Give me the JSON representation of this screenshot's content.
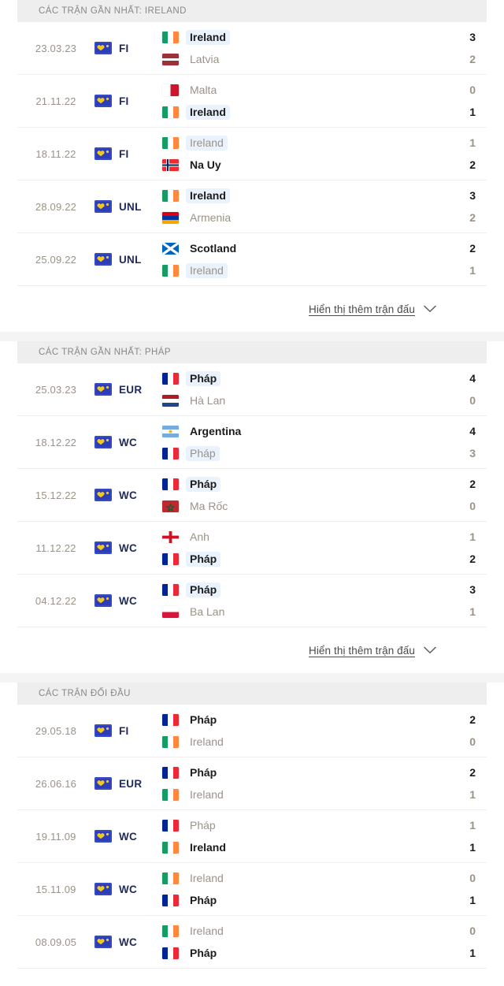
{
  "sections": [
    {
      "id": "recent-ireland",
      "title": "CÁC TRẬN GẦN NHẤT: IRELAND",
      "show_more": {
        "label": "Hiển thị thêm trận đấu",
        "icon": "chevron-down-icon"
      },
      "matches": [
        {
          "date": "23.03.23",
          "competition": "FI",
          "competition_icon": "competition-badge-icon",
          "home": {
            "name": "Ireland",
            "flag": "ireland",
            "winner": true,
            "highlight": true
          },
          "away": {
            "name": "Latvia",
            "flag": "latvia",
            "winner": false,
            "highlight": false
          },
          "home_score": "3",
          "away_score": "2"
        },
        {
          "date": "21.11.22",
          "competition": "FI",
          "competition_icon": "competition-badge-icon",
          "home": {
            "name": "Malta",
            "flag": "malta",
            "winner": false,
            "highlight": false
          },
          "away": {
            "name": "Ireland",
            "flag": "ireland",
            "winner": true,
            "highlight": true
          },
          "home_score": "0",
          "away_score": "1"
        },
        {
          "date": "18.11.22",
          "competition": "FI",
          "competition_icon": "competition-badge-icon",
          "home": {
            "name": "Ireland",
            "flag": "ireland",
            "winner": false,
            "highlight": true
          },
          "away": {
            "name": "Na Uy",
            "flag": "norway",
            "winner": true,
            "highlight": false
          },
          "home_score": "1",
          "away_score": "2"
        },
        {
          "date": "28.09.22",
          "competition": "UNL",
          "competition_icon": "competition-badge-icon",
          "home": {
            "name": "Ireland",
            "flag": "ireland",
            "winner": true,
            "highlight": true
          },
          "away": {
            "name": "Armenia",
            "flag": "armenia",
            "winner": false,
            "highlight": false
          },
          "home_score": "3",
          "away_score": "2"
        },
        {
          "date": "25.09.22",
          "competition": "UNL",
          "competition_icon": "competition-badge-icon",
          "home": {
            "name": "Scotland",
            "flag": "scotland",
            "winner": true,
            "highlight": false
          },
          "away": {
            "name": "Ireland",
            "flag": "ireland",
            "winner": false,
            "highlight": true
          },
          "home_score": "2",
          "away_score": "1"
        }
      ]
    },
    {
      "id": "recent-france",
      "title": "CÁC TRẬN GẦN NHẤT: PHÁP",
      "show_more": {
        "label": "Hiển thị thêm trận đấu",
        "icon": "chevron-down-icon"
      },
      "matches": [
        {
          "date": "25.03.23",
          "competition": "EUR",
          "competition_icon": "competition-badge-icon",
          "home": {
            "name": "Pháp",
            "flag": "france",
            "winner": true,
            "highlight": true
          },
          "away": {
            "name": "Hà Lan",
            "flag": "netherlands",
            "winner": false,
            "highlight": false
          },
          "home_score": "4",
          "away_score": "0"
        },
        {
          "date": "18.12.22",
          "competition": "WC",
          "competition_icon": "competition-badge-icon",
          "home": {
            "name": "Argentina",
            "flag": "argentina",
            "winner": true,
            "highlight": false
          },
          "away": {
            "name": "Pháp",
            "flag": "france",
            "winner": false,
            "highlight": true
          },
          "home_score": "4",
          "away_score": "3"
        },
        {
          "date": "15.12.22",
          "competition": "WC",
          "competition_icon": "competition-badge-icon",
          "home": {
            "name": "Pháp",
            "flag": "france",
            "winner": true,
            "highlight": true
          },
          "away": {
            "name": "Ma Rốc",
            "flag": "morocco",
            "winner": false,
            "highlight": false
          },
          "home_score": "2",
          "away_score": "0"
        },
        {
          "date": "11.12.22",
          "competition": "WC",
          "competition_icon": "competition-badge-icon",
          "home": {
            "name": "Anh",
            "flag": "england",
            "winner": false,
            "highlight": false
          },
          "away": {
            "name": "Pháp",
            "flag": "france",
            "winner": true,
            "highlight": true
          },
          "home_score": "1",
          "away_score": "2"
        },
        {
          "date": "04.12.22",
          "competition": "WC",
          "competition_icon": "competition-badge-icon",
          "home": {
            "name": "Pháp",
            "flag": "france",
            "winner": true,
            "highlight": true
          },
          "away": {
            "name": "Ba Lan",
            "flag": "poland",
            "winner": false,
            "highlight": false
          },
          "home_score": "3",
          "away_score": "1"
        }
      ]
    },
    {
      "id": "head-to-head",
      "title": "CÁC TRẬN ĐỐI ĐẦU",
      "show_more": null,
      "matches": [
        {
          "date": "29.05.18",
          "competition": "FI",
          "competition_icon": "competition-badge-icon",
          "home": {
            "name": "Pháp",
            "flag": "france",
            "winner": true,
            "highlight": false
          },
          "away": {
            "name": "Ireland",
            "flag": "ireland",
            "winner": false,
            "highlight": false
          },
          "home_score": "2",
          "away_score": "0"
        },
        {
          "date": "26.06.16",
          "competition": "EUR",
          "competition_icon": "competition-badge-icon",
          "home": {
            "name": "Pháp",
            "flag": "france",
            "winner": true,
            "highlight": false
          },
          "away": {
            "name": "Ireland",
            "flag": "ireland",
            "winner": false,
            "highlight": false
          },
          "home_score": "2",
          "away_score": "1"
        },
        {
          "date": "19.11.09",
          "competition": "WC",
          "competition_icon": "competition-badge-icon",
          "home": {
            "name": "Pháp",
            "flag": "france",
            "winner": false,
            "highlight": false
          },
          "away": {
            "name": "Ireland",
            "flag": "ireland",
            "winner": true,
            "highlight": false
          },
          "home_score": "1",
          "away_score": "1"
        },
        {
          "date": "15.11.09",
          "competition": "WC",
          "competition_icon": "competition-badge-icon",
          "home": {
            "name": "Ireland",
            "flag": "ireland",
            "winner": false,
            "highlight": false
          },
          "away": {
            "name": "Pháp",
            "flag": "france",
            "winner": true,
            "highlight": false
          },
          "home_score": "0",
          "away_score": "1"
        },
        {
          "date": "08.09.05",
          "competition": "WC",
          "competition_icon": "competition-badge-icon",
          "home": {
            "name": "Ireland",
            "flag": "ireland",
            "winner": false,
            "highlight": false
          },
          "away": {
            "name": "Pháp",
            "flag": "france",
            "winner": true,
            "highlight": false
          },
          "home_score": "0",
          "away_score": "1"
        }
      ]
    }
  ],
  "colors": {
    "header_bg": "#eeeeee",
    "header_text": "#888888",
    "muted_text": "#9a9386",
    "winner_text": "#1c1c1c",
    "highlight_bg": "#eaf3fd",
    "badge_bg": "#2d3db8",
    "badge_emblem": "#f2c81e",
    "divider": "#eeeeee",
    "page_gap": "#f4f4f4"
  }
}
